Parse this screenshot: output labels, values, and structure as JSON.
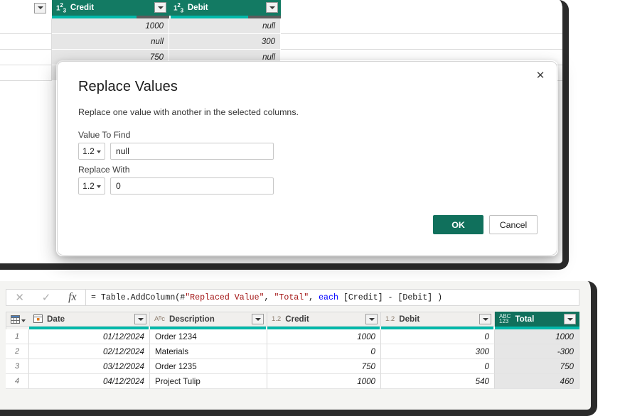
{
  "colors": {
    "accent_green": "#137a63",
    "button_green": "#10705c",
    "quality_ok": "#01b8aa",
    "quality_error": "#5c5c5c",
    "frame_dark": "#2b2b2b",
    "selected_cell": "#e6e6e6"
  },
  "top_grid": {
    "columns": [
      {
        "name": "Credit",
        "type_icon": "1²₃",
        "type_label": "whole-number"
      },
      {
        "name": "Debit",
        "type_icon": "1²₃",
        "type_label": "whole-number"
      }
    ],
    "quality": [
      {
        "valid_pct": 72,
        "error_pct": 28
      },
      {
        "valid_pct": 70,
        "error_pct": 30
      }
    ],
    "rows": [
      {
        "credit": "1000",
        "debit": "null"
      },
      {
        "credit": "null",
        "debit": "300"
      },
      {
        "credit": "750",
        "debit": "null"
      }
    ]
  },
  "dialog": {
    "title": "Replace Values",
    "subtitle": "Replace one value with another in the selected columns.",
    "close_label": "✕",
    "value_to_find": {
      "label": "Value To Find",
      "type_selector": "1.2",
      "value": "null",
      "placeholder": ""
    },
    "replace_with": {
      "label": "Replace With",
      "type_selector": "1.2",
      "value": "0",
      "placeholder": ""
    },
    "ok_label": "OK",
    "cancel_label": "Cancel"
  },
  "formula_bar": {
    "cancel_icon": "✕",
    "accept_icon": "✓",
    "fx_icon": "fx",
    "formula_parts": [
      {
        "text": "= Table.AddColumn(#",
        "kind": "plain"
      },
      {
        "text": "\"Replaced Value\"",
        "kind": "string"
      },
      {
        "text": ", ",
        "kind": "plain"
      },
      {
        "text": "\"Total\"",
        "kind": "string"
      },
      {
        "text": ", ",
        "kind": "plain"
      },
      {
        "text": "each",
        "kind": "keyword"
      },
      {
        "text": " [Credit] - [Debit] )",
        "kind": "plain"
      }
    ],
    "formula_text": "= Table.AddColumn(#\"Replaced Value\", \"Total\", each [Credit] - [Debit] )"
  },
  "bottom_grid": {
    "corner_icon": "table-select-icon",
    "columns": [
      {
        "name": "Date",
        "type_icon": "calendar",
        "type_text": "",
        "selected": false
      },
      {
        "name": "Description",
        "type_icon": "text",
        "type_text": "Aᴮᴄ",
        "selected": false
      },
      {
        "name": "Credit",
        "type_icon": "decimal",
        "type_text": "1.2",
        "selected": false
      },
      {
        "name": "Debit",
        "type_icon": "decimal",
        "type_text": "1.2",
        "selected": false
      },
      {
        "name": "Total",
        "type_icon": "any",
        "type_text": "ABC123",
        "selected": true
      }
    ],
    "rows": [
      {
        "num": "1",
        "date": "01/12/2024",
        "description": "Order 1234",
        "credit": "1000",
        "debit": "0",
        "total": "1000"
      },
      {
        "num": "2",
        "date": "02/12/2024",
        "description": "Materials",
        "credit": "0",
        "debit": "300",
        "total": "-300"
      },
      {
        "num": "3",
        "date": "03/12/2024",
        "description": "Order 1235",
        "credit": "750",
        "debit": "0",
        "total": "750"
      },
      {
        "num": "4",
        "date": "04/12/2024",
        "description": "Project Tulip",
        "credit": "1000",
        "debit": "540",
        "total": "460"
      }
    ]
  }
}
